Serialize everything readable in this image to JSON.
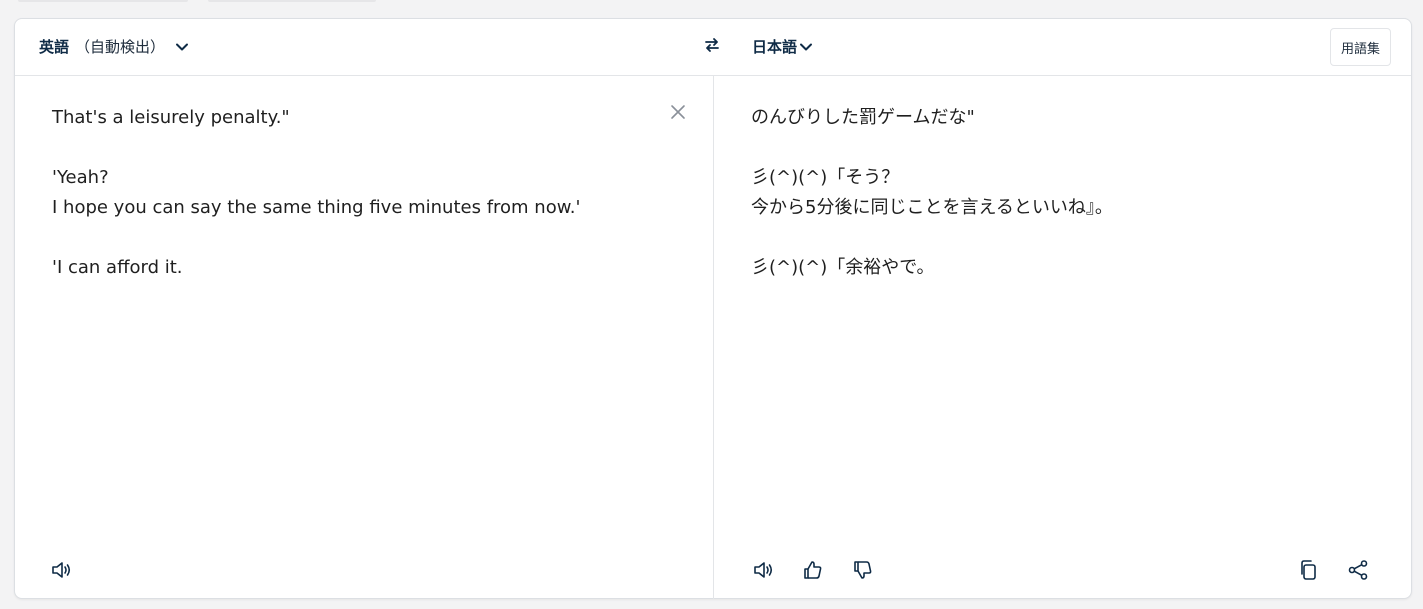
{
  "header": {
    "source_language": "英語",
    "source_detect": "（自動検出）",
    "target_language": "日本語",
    "glossary_label": "用語集"
  },
  "source": {
    "text": "That's a leisurely penalty.\"\n\n'Yeah?\nI hope you can say the same thing five minutes from now.'\n\n'I can afford it."
  },
  "target": {
    "text": "のんびりした罰ゲームだな\"\n\n彡(^)(^)「そう？\n今から5分後に同じことを言えるといいね』。\n\n彡(^)(^)「余裕やで。"
  },
  "icons": {
    "swap": "swap-arrows-icon",
    "clear": "close-icon",
    "speaker": "speaker-icon",
    "thumbs_up": "thumbs-up-icon",
    "thumbs_down": "thumbs-down-icon",
    "copy": "copy-icon",
    "share": "share-icon"
  },
  "colors": {
    "accent": "#0f2b46",
    "border": "#dcdfe3"
  }
}
